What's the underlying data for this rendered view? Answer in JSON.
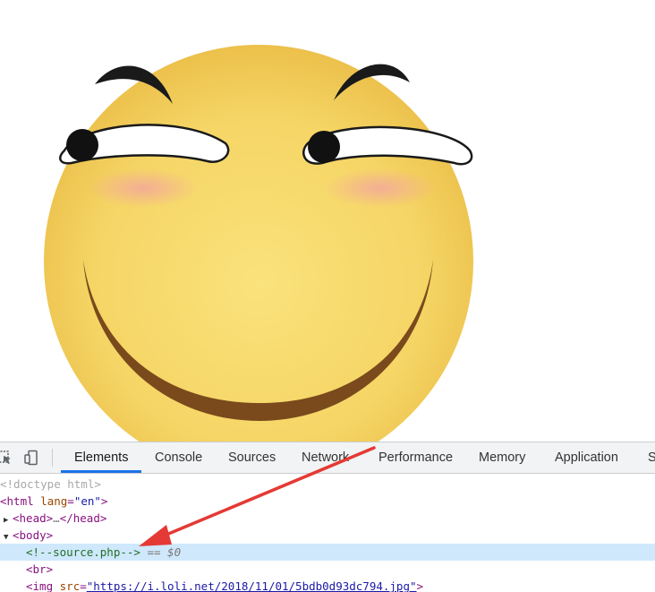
{
  "devtools": {
    "tabs": [
      {
        "label": "Elements",
        "active": true
      },
      {
        "label": "Console"
      },
      {
        "label": "Sources"
      },
      {
        "label": "Network"
      },
      {
        "label": "Performance"
      },
      {
        "label": "Memory"
      },
      {
        "label": "Application"
      },
      {
        "label": "S"
      }
    ],
    "accent_color": "#1a73e8",
    "selected_row_color": "#cfe8fc",
    "dom": {
      "doctype": "<!doctype html>",
      "html_open": "<html",
      "html_attr": "lang",
      "html_eq": "=",
      "html_val": "\"en\"",
      "html_close": ">",
      "head": "<head>",
      "head_ellipsis": "…",
      "head_close": "</head>",
      "body": "<body>",
      "comment": "<!--source.php-->",
      "comment_suffix": "== $0",
      "br": "<br>",
      "img_open": "<img",
      "img_attr": "src",
      "img_eq": "=",
      "img_val": "\"https://i.loli.net/2018/11/01/5bdb0d93dc794.jpg\"",
      "img_close": ">"
    }
  },
  "annotation": {
    "arrow_color": "#e53935"
  },
  "image": {
    "subject": "smirking-emoji-face"
  }
}
